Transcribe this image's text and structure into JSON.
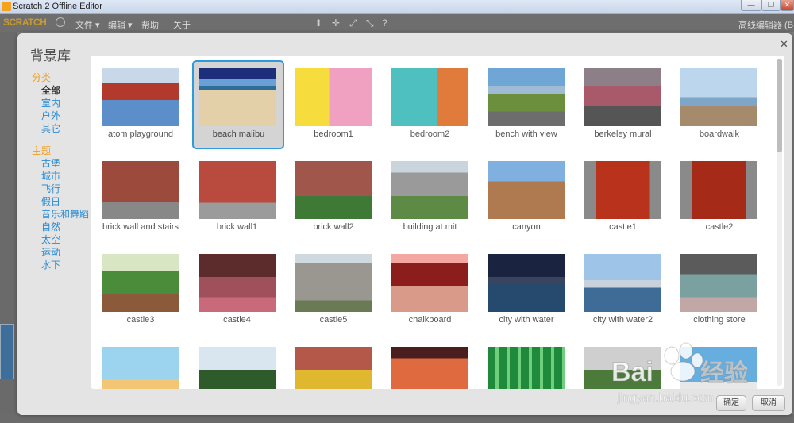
{
  "window": {
    "title": "Scratch 2 Offline Editor",
    "min": "—",
    "max": "❐",
    "close": "✕"
  },
  "menubar": {
    "logo": "SCRATCH",
    "file": "文件 ▾",
    "edit": "编辑 ▾",
    "help": "帮助",
    "about": "关于",
    "tools": [
      "⬆",
      "✛",
      "⤢",
      "⤡",
      "?"
    ],
    "right": "高线编辑器 (B"
  },
  "dialog": {
    "title": "背景库",
    "close": "✕",
    "ok_label": "确定",
    "cancel_label": "取消"
  },
  "sidebar": {
    "category_header": "分类",
    "categories": [
      "全部",
      "室内",
      "户外",
      "其它"
    ],
    "theme_header": "主题",
    "themes": [
      "古堡",
      "城市",
      "飞行",
      "假日",
      "音乐和舞蹈",
      "自然",
      "太空",
      "运动",
      "水下"
    ],
    "selected": "全部"
  },
  "backdrops": [
    {
      "label": "atom playground"
    },
    {
      "label": "beach malibu",
      "selected": true
    },
    {
      "label": "bedroom1"
    },
    {
      "label": "bedroom2"
    },
    {
      "label": "bench with view"
    },
    {
      "label": "berkeley mural"
    },
    {
      "label": "boardwalk"
    },
    {
      "label": "brick wall and stairs"
    },
    {
      "label": "brick wall1"
    },
    {
      "label": "brick wall2"
    },
    {
      "label": "building at mit"
    },
    {
      "label": "canyon"
    },
    {
      "label": "castle1"
    },
    {
      "label": "castle2"
    },
    {
      "label": "castle3"
    },
    {
      "label": "castle4"
    },
    {
      "label": "castle5"
    },
    {
      "label": "chalkboard"
    },
    {
      "label": "city with water"
    },
    {
      "label": "city with water2"
    },
    {
      "label": "clothing store"
    },
    {
      "label": ""
    },
    {
      "label": ""
    },
    {
      "label": ""
    },
    {
      "label": ""
    },
    {
      "label": ""
    },
    {
      "label": ""
    },
    {
      "label": ""
    }
  ],
  "watermark": {
    "brand": "Bai",
    "mid": "du",
    "suffix": "经验",
    "url": "jingyan.baidu.com"
  }
}
